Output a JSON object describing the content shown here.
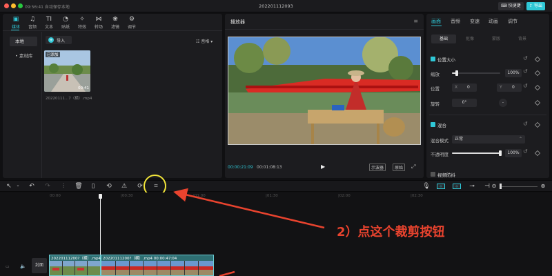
{
  "titlebar": {
    "left_status": "09:56:41 自动保存本地",
    "project_title": "202201112093",
    "shortcut_label": "快捷键",
    "export_label": "导出"
  },
  "toolbar_tabs": [
    {
      "label": "媒体",
      "icon": "media-icon",
      "glyph": "▣"
    },
    {
      "label": "音频",
      "icon": "audio-icon",
      "glyph": "♫"
    },
    {
      "label": "文本",
      "icon": "text-icon",
      "glyph": "TI"
    },
    {
      "label": "贴纸",
      "icon": "sticker-icon",
      "glyph": "◔"
    },
    {
      "label": "特效",
      "icon": "effects-icon",
      "glyph": "✧"
    },
    {
      "label": "转场",
      "icon": "transition-icon",
      "glyph": "⋈"
    },
    {
      "label": "滤镜",
      "icon": "filter-icon",
      "glyph": "❀"
    },
    {
      "label": "调节",
      "icon": "adjust-icon",
      "glyph": "⚙"
    }
  ],
  "media": {
    "local_label": "本地",
    "library_label": "• 素材库",
    "import_label": "导入",
    "sort_label": "音格",
    "clip_badge": "已添加",
    "clip_duration": "00:41",
    "clip_name": "20220111...7（横）.mp4"
  },
  "player": {
    "title": "播放器",
    "current_time": "00:00:21:09",
    "total_time": "00:01:08:13",
    "waveform_label": "示波器",
    "ratio_label": "原始"
  },
  "props": {
    "tabs": [
      "画面",
      "音频",
      "变速",
      "动画",
      "调节"
    ],
    "subtabs": [
      "基础",
      "抠像",
      "蒙版",
      "背景"
    ],
    "pos_size_label": "位置大小",
    "scale_label": "缩放",
    "scale_value": "100%",
    "scale_fraction": 0.1,
    "position_label": "位置",
    "x_label": "X",
    "x_value": "0",
    "y_label": "Y",
    "y_value": "0",
    "rotate_label": "旋转",
    "rotate_value": "0°",
    "blend_label": "混合",
    "blend_mode_label": "混合模式",
    "blend_mode_value": "正常",
    "opacity_label": "不透明度",
    "opacity_value": "100%",
    "opacity_fraction": 1.0,
    "stabilize_label": "视频防抖"
  },
  "timeline": {
    "ticks": [
      "00:00",
      "|00:30",
      "|01:00",
      "|01:30",
      "|02:00",
      "|02:30"
    ],
    "cover_label": "封面",
    "clip1_label": "20220111200?（横）.mp4",
    "clip2_label": "20220111200?（横）.mp4  00:00:47:04"
  },
  "annotation": {
    "text": "2）点这个裁剪按钮",
    "color": "#e8432e"
  },
  "colors": {
    "accent": "#2fc7d6",
    "highlight_circle": "#f3e63a"
  }
}
